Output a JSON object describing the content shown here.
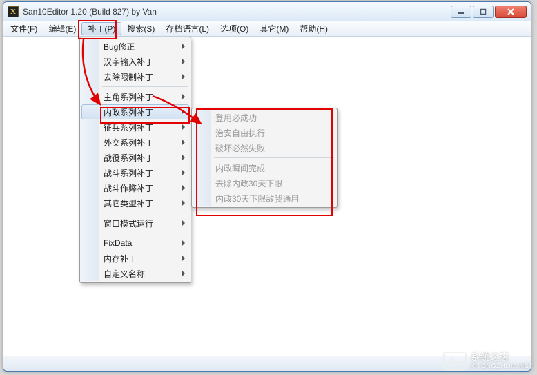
{
  "window": {
    "title": "San10Editor 1.20 (Build 827) by Van",
    "icon_letter": "X"
  },
  "window_controls": {
    "min_tip": "Minimize",
    "max_tip": "Maximize",
    "close_tip": "Close"
  },
  "menubar": [
    {
      "label": "文件(F)"
    },
    {
      "label": "编辑(E)"
    },
    {
      "label": "补丁(P)",
      "active": true
    },
    {
      "label": "搜索(S)"
    },
    {
      "label": "存档语言(L)"
    },
    {
      "label": "选项(O)"
    },
    {
      "label": "其它(M)"
    },
    {
      "label": "帮助(H)"
    }
  ],
  "patch_menu": {
    "groups": [
      [
        {
          "label": "Bug修正",
          "submenu": true
        },
        {
          "label": "汉字输入补丁",
          "submenu": true
        },
        {
          "label": "去除限制补丁",
          "submenu": true
        }
      ],
      [
        {
          "label": "主角系列补丁",
          "submenu": true
        },
        {
          "label": "内政系列补丁",
          "submenu": true,
          "hover": true
        },
        {
          "label": "征兵系列补丁",
          "submenu": true
        },
        {
          "label": "外交系列补丁",
          "submenu": true
        },
        {
          "label": "战役系列补丁",
          "submenu": true
        },
        {
          "label": "战斗系列补丁",
          "submenu": true
        },
        {
          "label": "战斗作弊补丁",
          "submenu": true
        },
        {
          "label": "其它类型补丁",
          "submenu": true
        }
      ],
      [
        {
          "label": "窗口模式运行",
          "submenu": true
        }
      ],
      [
        {
          "label": "FixData",
          "submenu": true
        },
        {
          "label": "内存补丁",
          "submenu": true
        },
        {
          "label": "自定义名称",
          "submenu": true
        }
      ]
    ]
  },
  "neizheng_submenu": {
    "groups": [
      [
        {
          "label": "登用必成功",
          "disabled": true
        },
        {
          "label": "治安自由执行",
          "disabled": true
        },
        {
          "label": "破坏必然失败",
          "disabled": true
        }
      ],
      [
        {
          "label": "内政瞬间完成",
          "disabled": true
        },
        {
          "label": "去除内政30天下限",
          "disabled": true
        },
        {
          "label": "内政30天下限敌我通用",
          "disabled": true
        }
      ]
    ]
  },
  "watermark": {
    "main": "系统之家",
    "sub": "XITONGZHIJIA.NET"
  }
}
